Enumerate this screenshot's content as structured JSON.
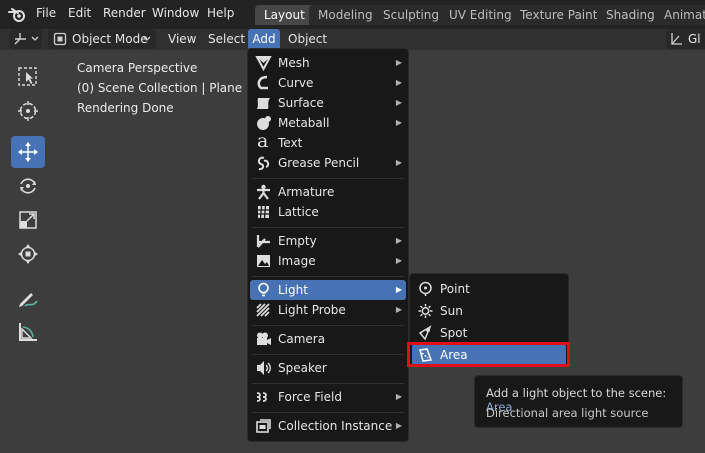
{
  "topbar": {
    "menus": [
      "File",
      "Edit",
      "Render",
      "Window",
      "Help"
    ],
    "workspaces": [
      {
        "label": "Layout",
        "active": true
      },
      {
        "label": "Modeling",
        "active": false
      },
      {
        "label": "Sculpting",
        "active": false
      },
      {
        "label": "UV Editing",
        "active": false
      },
      {
        "label": "Texture Paint",
        "active": false
      },
      {
        "label": "Shading",
        "active": false
      },
      {
        "label": "Animati",
        "active": false
      }
    ]
  },
  "header": {
    "mode_label": "Object Mode",
    "menus": [
      "View",
      "Select",
      "Add",
      "Object"
    ],
    "right_label": "Gl"
  },
  "viewport": {
    "overlay_lines": [
      "Camera Perspective",
      "(0) Scene Collection | Plane",
      "Rendering Done"
    ]
  },
  "add_menu": {
    "items": [
      {
        "label": "Mesh",
        "icon": "mesh-icon",
        "submenu": true
      },
      {
        "label": "Curve",
        "icon": "curve-icon",
        "submenu": true
      },
      {
        "label": "Surface",
        "icon": "surface-icon",
        "submenu": true
      },
      {
        "label": "Metaball",
        "icon": "metaball-icon",
        "submenu": true
      },
      {
        "label": "Text",
        "icon": "text-icon",
        "submenu": false
      },
      {
        "label": "Grease Pencil",
        "icon": "grease-pencil-icon",
        "submenu": true
      },
      {
        "label": "Armature",
        "icon": "armature-icon",
        "submenu": false
      },
      {
        "label": "Lattice",
        "icon": "lattice-icon",
        "submenu": false
      },
      {
        "label": "Empty",
        "icon": "empty-icon",
        "submenu": true
      },
      {
        "label": "Image",
        "icon": "image-icon",
        "submenu": true
      },
      {
        "label": "Light",
        "icon": "light-icon",
        "submenu": true,
        "highlighted": true
      },
      {
        "label": "Light Probe",
        "icon": "light-probe-icon",
        "submenu": true
      },
      {
        "label": "Camera",
        "icon": "camera-icon",
        "submenu": false
      },
      {
        "label": "Speaker",
        "icon": "speaker-icon",
        "submenu": false
      },
      {
        "label": "Force Field",
        "icon": "force-field-icon",
        "submenu": true
      },
      {
        "label": "Collection Instance",
        "icon": "collection-instance-icon",
        "submenu": true
      }
    ]
  },
  "light_submenu": {
    "items": [
      {
        "label": "Point",
        "icon": "point-light-icon"
      },
      {
        "label": "Sun",
        "icon": "sun-light-icon"
      },
      {
        "label": "Spot",
        "icon": "spot-light-icon"
      },
      {
        "label": "Area",
        "icon": "area-light-icon",
        "highlighted": true
      }
    ]
  },
  "tooltip": {
    "line1": "Add a light object to the scene:",
    "line1_value": "Area",
    "line2": "Directional area light source"
  },
  "colors": {
    "accent": "#4772b3",
    "annotation_red": "#e10d17",
    "menu_bg": "#181818",
    "viewport_bg": "#3d3d3d"
  }
}
